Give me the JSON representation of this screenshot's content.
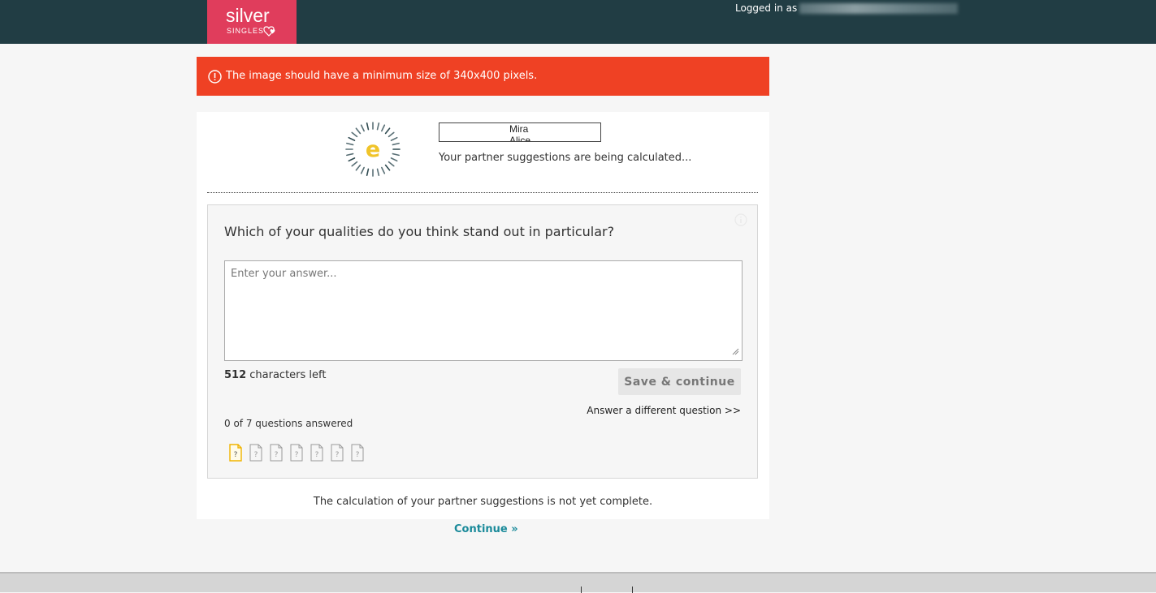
{
  "header": {
    "logo": {
      "word": "silver",
      "sub": "SINGLES"
    },
    "login_prefix": "Logged in as",
    "colors": {
      "bar": "#213d44",
      "logo": "#e03d5c"
    }
  },
  "alert": {
    "message": "The image should have a minimum size of 340x400 pixels.",
    "icon": "exclamation-circle-icon",
    "color": "#ef4124"
  },
  "status": {
    "spinner_letter": "e",
    "names": [
      "Mira",
      "Alice"
    ],
    "calculating": "Your partner suggestions are being calculated..."
  },
  "question_panel": {
    "question": "Which of your qualities do you think stand out in particular?",
    "answer_placeholder": "Enter your answer...",
    "answer_value": "",
    "chars_left_count": "512",
    "chars_left_label": " characters left",
    "save_label": "Save & continue",
    "different_question_label": "Answer a different question >>",
    "answered_label": "0 of 7 questions answered",
    "question_icons": {
      "total": 7,
      "current": 1,
      "glyph": "?"
    }
  },
  "footnote": "The calculation of your partner suggestions is not yet complete.",
  "continue_label": "Continue »"
}
